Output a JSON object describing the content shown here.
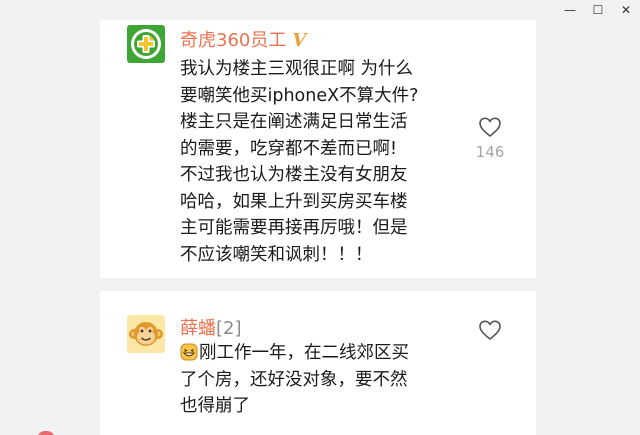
{
  "window": {
    "controls": [
      "—",
      "☐",
      "✕"
    ]
  },
  "comments": [
    {
      "avatar_icon": "360-logo-icon",
      "username": "奇虎360员工",
      "verified_badge": "V",
      "content_lines": [
        "我认为楼主三观很正啊  为什么",
        "要嘲笑他买iphoneX不算大件?",
        "楼主只是在阐述满足日常生活",
        "的需要，吃穿都不差而已啊!",
        "不过我也认为楼主没有女朋友",
        "哈哈，如果上升到买房买车楼",
        "主可能需要再接再厉哦！但是",
        "不应该嘲笑和讽刺！！！"
      ],
      "likes": "146"
    },
    {
      "avatar_icon": "monkey-avatar-icon",
      "username": "薛蟠",
      "floor": "[2]",
      "emoji_icon": "grin-emoji-icon",
      "content_lines": [
        "刚工作一年，在二线郊区买",
        "了个房，还好没对象，要不然",
        "也得崩了"
      ]
    }
  ],
  "colors": {
    "background": "#f1f2f4",
    "card": "#ffffff",
    "username": "#eb7350",
    "verified": "#e8a33c",
    "text": "#1a1a1a",
    "muted": "#a6a6a6"
  }
}
